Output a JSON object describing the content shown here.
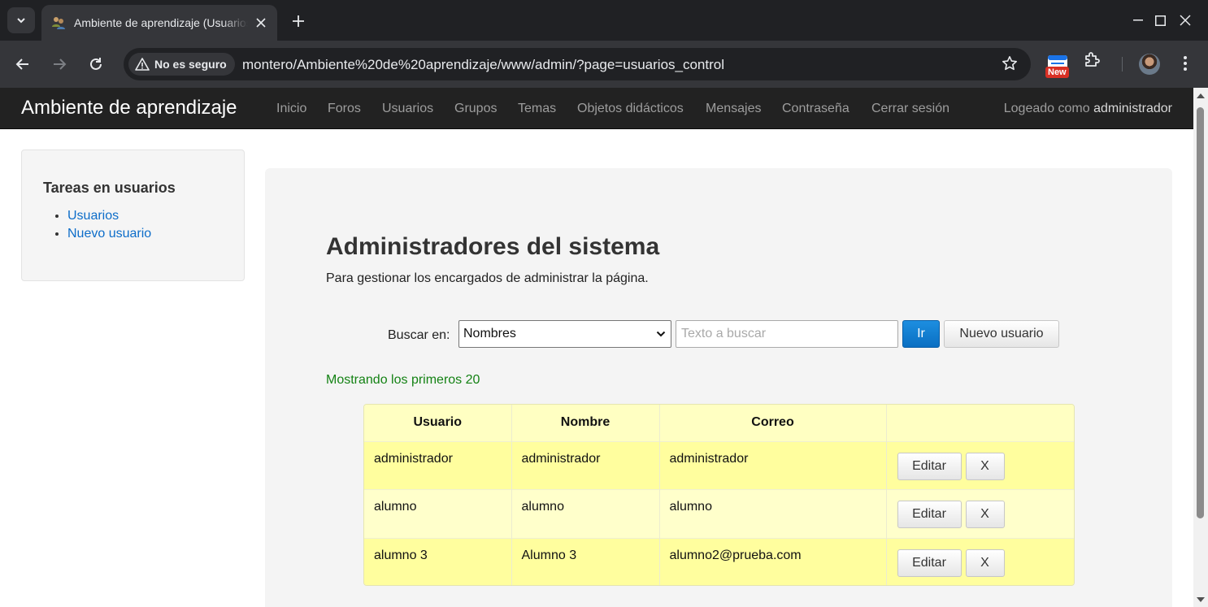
{
  "browser": {
    "tab_title": "Ambiente de aprendizaje (Usuarios)",
    "security_label": "No es seguro",
    "url": "montero/Ambiente%20de%20aprendizaje/www/admin/?page=usuarios_control",
    "extension_badge": "New"
  },
  "navbar": {
    "brand": "Ambiente de aprendizaje",
    "links": [
      "Inicio",
      "Foros",
      "Usuarios",
      "Grupos",
      "Temas",
      "Objetos didácticos",
      "Mensajes",
      "Contraseña",
      "Cerrar sesión"
    ],
    "logged_prefix": "Logeado como",
    "logged_user": "administrador"
  },
  "sidebar": {
    "title": "Tareas en usuarios",
    "items": [
      "Usuarios",
      "Nuevo usuario"
    ]
  },
  "main": {
    "title": "Administradores del sistema",
    "subtitle": "Para gestionar los encargados de administrar la página.",
    "search": {
      "label": "Buscar en:",
      "selected": "Nombres",
      "placeholder": "Texto a buscar",
      "go_label": "Ir",
      "new_user_label": "Nuevo usuario"
    },
    "result_info": "Mostrando los primeros 20",
    "table": {
      "headers": [
        "Usuario",
        "Nombre",
        "Correo",
        ""
      ],
      "rows": [
        {
          "usuario": "administrador",
          "nombre": "administrador",
          "correo": "administrador"
        },
        {
          "usuario": "alumno",
          "nombre": "alumno",
          "correo": "alumno"
        },
        {
          "usuario": "alumno 3",
          "nombre": "Alumno 3",
          "correo": "alumno2@prueba.com"
        }
      ],
      "edit_label": "Editar",
      "delete_label": "X"
    }
  },
  "colors": {
    "navbar_bg": "#222222",
    "link": "#0d6dc9",
    "primary_button": "#0a6fc2",
    "success_text": "#148214",
    "row_odd": "#fffe9e",
    "row_even": "#ffffcb"
  }
}
